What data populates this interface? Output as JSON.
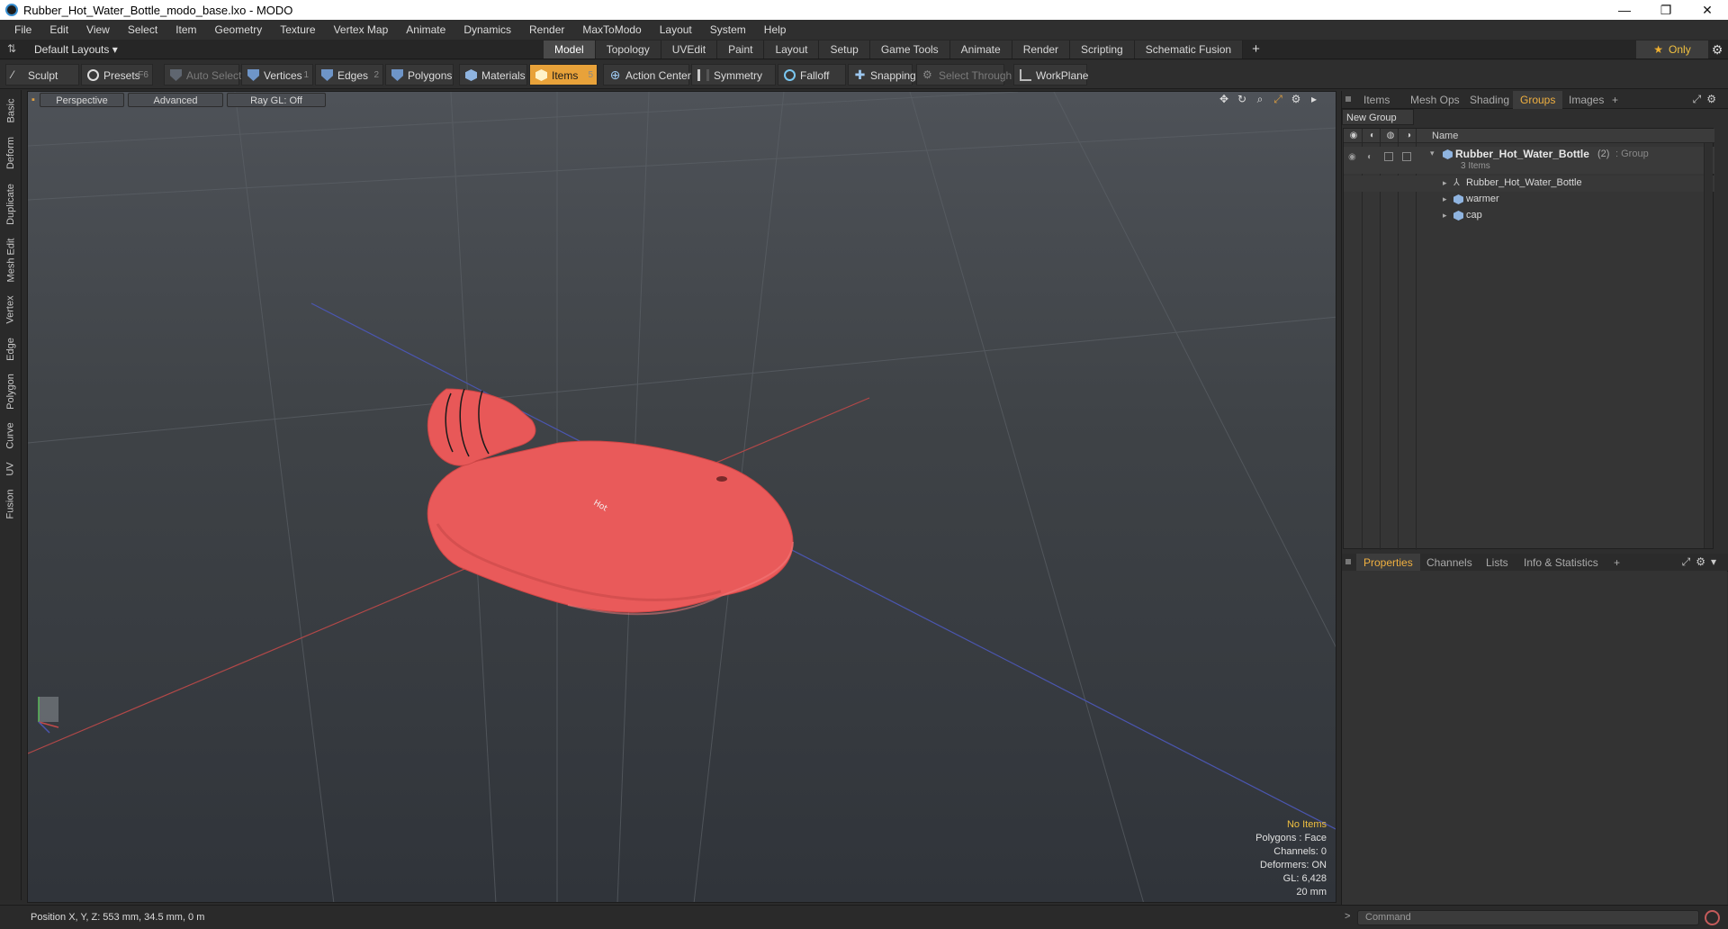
{
  "window": {
    "title": "Rubber_Hot_Water_Bottle_modo_base.lxo - MODO",
    "minimize": "—",
    "maximize": "❐",
    "close": "✕"
  },
  "menu": [
    "File",
    "Edit",
    "View",
    "Select",
    "Item",
    "Geometry",
    "Texture",
    "Vertex Map",
    "Animate",
    "Dynamics",
    "Render",
    "MaxToModo",
    "Layout",
    "System",
    "Help"
  ],
  "layout_bar": {
    "layout_select": "Default Layouts ▾",
    "tabs": [
      "Model",
      "Topology",
      "UVEdit",
      "Paint",
      "Layout",
      "Setup",
      "Game Tools",
      "Animate",
      "Render",
      "Scripting",
      "Schematic Fusion"
    ],
    "active_tab": "Model",
    "add_tab": "+",
    "only_label": "Only",
    "star": "★",
    "gear": "⚙"
  },
  "toolbar": {
    "sculpt": "Sculpt",
    "presets": "Presets",
    "presets_key": "F6",
    "auto_select": "Auto Select",
    "vertices": "Vertices",
    "vertices_key": "1",
    "edges": "Edges",
    "edges_key": "2",
    "polygons": "Polygons",
    "materials": "Materials",
    "items": "Items",
    "items_key": "5",
    "action_center": "Action Center",
    "symmetry": "Symmetry",
    "falloff": "Falloff",
    "snapping": "Snapping",
    "select_through": "Select Through",
    "workplane": "WorkPlane"
  },
  "left_tabs": [
    "Basic",
    "Deform",
    "Duplicate",
    "Mesh Edit",
    "Vertex",
    "Edge",
    "Polygon",
    "Curve",
    "UV",
    "Fusion"
  ],
  "viewport": {
    "view_mode": "Perspective",
    "shading": "Advanced",
    "raygl": "Ray GL: Off",
    "info": {
      "selection": "No Items",
      "polygons": "Polygons : Face",
      "channels": "Channels: 0",
      "deformers": "Deformers: ON",
      "gl": "GL: 6,428",
      "scale": "20 mm"
    },
    "colors": {
      "bottle": "#ee5a5a",
      "x_axis": "#c24a4a",
      "z_axis": "#4a55b0"
    }
  },
  "status": {
    "position": "Position X, Y, Z:  553 mm, 34.5 mm, 0 m"
  },
  "right_top_tabs": {
    "tabs": [
      "Items",
      "Mesh Ops",
      "Shading",
      "Groups",
      "Images"
    ],
    "active": "Groups",
    "add": "+"
  },
  "groups": {
    "new_group": "New Group",
    "col_name": "Name",
    "group_name": "Rubber_Hot_Water_Bottle",
    "group_count": "(2)",
    "group_type": ": Group",
    "group_items": "3 Items",
    "children": [
      "Rubber_Hot_Water_Bottle",
      "warmer",
      "cap"
    ]
  },
  "right_bottom_tabs": {
    "tabs": [
      "Properties",
      "Channels",
      "Lists",
      "Info & Statistics"
    ],
    "active": "Properties",
    "add": "+"
  },
  "command": {
    "prompt": ">",
    "placeholder": "Command"
  }
}
